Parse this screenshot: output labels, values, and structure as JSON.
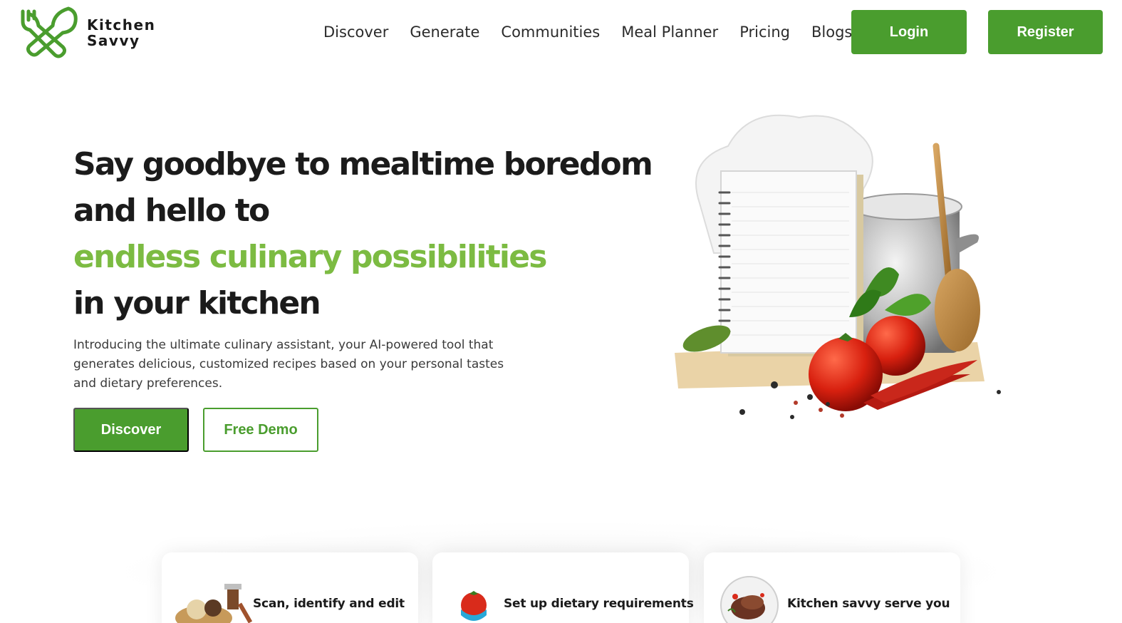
{
  "brand": {
    "line1": "Kitchen",
    "line2": "Savvy",
    "color": "#4a9d2e"
  },
  "nav": {
    "items": [
      {
        "label": "Discover"
      },
      {
        "label": "Generate"
      },
      {
        "label": "Communities"
      },
      {
        "label": "Meal Planner"
      },
      {
        "label": "Pricing"
      },
      {
        "label": "Blogs"
      }
    ],
    "login_label": "Login",
    "register_label": "Register"
  },
  "hero": {
    "line1": "Say goodbye to mealtime boredom",
    "line2": "and hello to",
    "line3_accent": "endless culinary possibilities",
    "line4": "in your kitchen",
    "description": "Introducing the ultimate culinary assistant, your AI-powered tool that generates delicious, customized recipes based on your personal tastes and dietary preferences.",
    "discover_label": "Discover",
    "demo_label": "Free Demo",
    "accent_color": "#7cbb42"
  },
  "features": [
    {
      "text": "Scan, identify and edit",
      "icon": "spices-icon"
    },
    {
      "text": "Set up dietary requirements",
      "icon": "tomato-measuring-tape-icon"
    },
    {
      "text": "Kitchen savvy serve you",
      "icon": "steak-plate-icon"
    }
  ]
}
